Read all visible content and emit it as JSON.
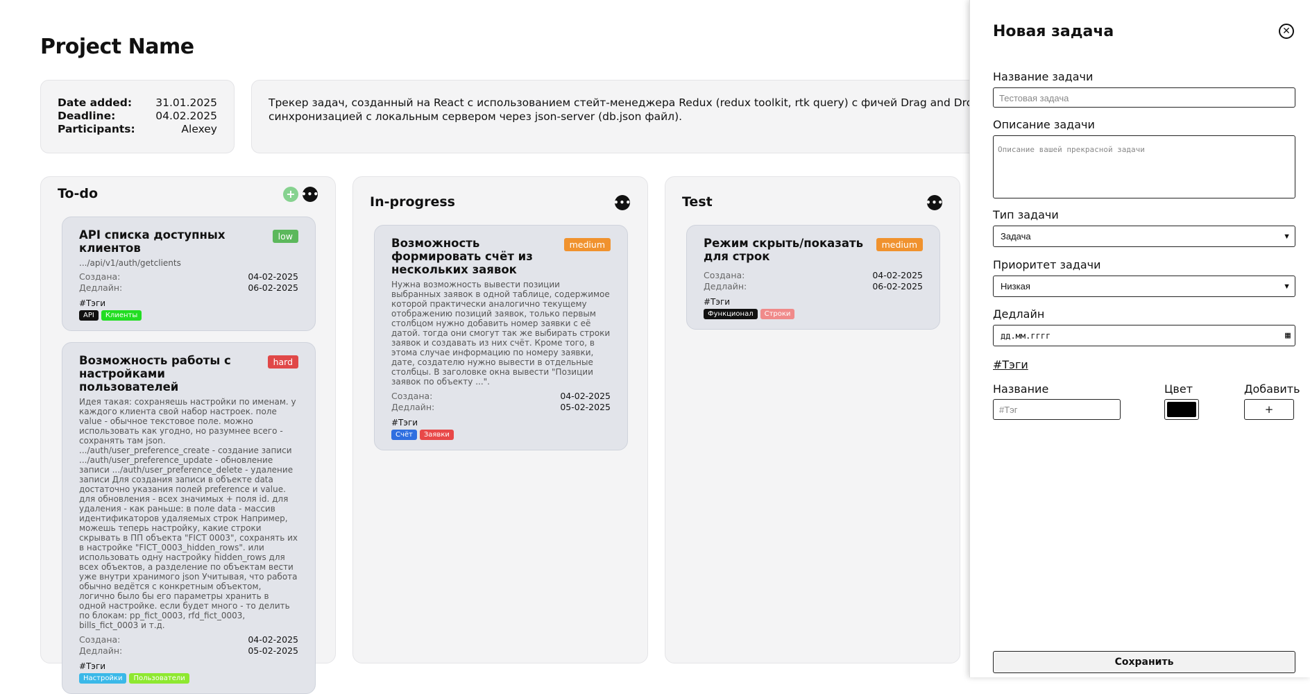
{
  "project": {
    "title": "Project Name",
    "info": {
      "date_added_label": "Date added:",
      "date_added": "31.01.2025",
      "deadline_label": "Deadline:",
      "deadline": "04.02.2025",
      "participants_label": "Participants:",
      "participants": "Alexey"
    },
    "description": "Трекер задач, созданный на React с использованием стейт-менеджера Redux (redux toolkit, rtk query) с фичей Drag and Drop (библиотека react-beautiful-dnd / drag-and-drop) и синхронизацией с локальным сервером через json-server (db.json файл)."
  },
  "columns": [
    {
      "title": "To-do",
      "add_icon": "plus-icon",
      "more_icon": "ellipsis-icon",
      "cards": [
        {
          "title": "API списка доступных клиентов",
          "priority": "low",
          "priority_color": "#5cb85c",
          "description": ".../api/v1/auth/getclients",
          "created_label": "Создана:",
          "created": "04-02-2025",
          "deadline_label": "Дедлайн:",
          "deadline": "06-02-2025",
          "tags_label": "#Тэги",
          "tags": [
            {
              "name": "API",
              "color": "#111111"
            },
            {
              "name": "Клиенты",
              "color": "#22dd22"
            }
          ]
        },
        {
          "title": "Возможность работы с настройками пользователей",
          "priority": "hard",
          "priority_color": "#e04848",
          "description": "Идея такая: сохраняешь настройки по именам. у каждого клиента свой набор настроек. поле value - обычное текстовое поле. можно использовать как угодно, но разумнее всего - сохранять там json. .../auth/user_preference_create - создание записи .../auth/user_preference_update - обновление записи .../auth/user_preference_delete - удаление записи Для создания записи в объекте data достаточно указания полей preference и value. для обновления - всех значимых + поля id. для удаления - как раньше: в поле data - массив идентификаторов удаляемых строк Например, можешь теперь настройку, какие строки скрывать в ПП объекта \"FICT 0003\", сохранять их в настройке \"FICT_0003_hidden_rows\". или использовать одну настройку hidden_rows для всех объектов, а разделение по объектам вести уже внутри хранимого json Учитывая, что работа обычно ведётся с конкретным объектом, логично было бы его параметры хранить в одной настройке. если будет много - то делить по блокам: pp_fict_0003, rfd_fict_0003, bills_fict_0003 и т.д.",
          "created_label": "Создана:",
          "created": "04-02-2025",
          "deadline_label": "Дедлайн:",
          "deadline": "05-02-2025",
          "tags_label": "#Тэги",
          "tags": [
            {
              "name": "Настройки",
              "color": "#3ab8e8"
            },
            {
              "name": "Пользователи",
              "color": "#8ee830"
            }
          ]
        }
      ]
    },
    {
      "title": "In-progress",
      "more_icon": "ellipsis-icon",
      "cards": [
        {
          "title": "Возможность формировать счёт из нескольких заявок",
          "priority": "medium",
          "priority_color": "#f0922e",
          "description": "Нужна возможность вывести позиции выбранных заявок в одной таблице, содержимое которой практически аналогично текущему отображению позиций заявок, только первым столбцом нужно добавить номер заявки с её датой. тогда они смогут так же выбирать строки заявок и создавать из них счёт. Кроме того, в этома случае информацию по номеру заявки, дате, создателю нужно вывести в отдельные столбцы. В заголовке окна вывести \"Позиции заявок по объекту ...\".",
          "created_label": "Создана:",
          "created": "04-02-2025",
          "deadline_label": "Дедлайн:",
          "deadline": "05-02-2025",
          "tags_label": "#Тэги",
          "tags": [
            {
              "name": "Счёт",
              "color": "#2f6fe0"
            },
            {
              "name": "Заявки",
              "color": "#e84848"
            }
          ]
        }
      ]
    },
    {
      "title": "Test",
      "more_icon": "ellipsis-icon",
      "cards": [
        {
          "title": "Режим скрыть/показать для строк",
          "priority": "medium",
          "priority_color": "#f0922e",
          "description": "",
          "created_label": "Создана:",
          "created": "04-02-2025",
          "deadline_label": "Дедлайн:",
          "deadline": "06-02-2025",
          "tags_label": "#Тэги",
          "tags": [
            {
              "name": "Функционал",
              "color": "#111111"
            },
            {
              "name": "Строки",
              "color": "#f08a8a"
            }
          ]
        }
      ]
    }
  ],
  "panel": {
    "title": "Новая задача",
    "close_icon": "close-icon",
    "task_name_label": "Название задачи",
    "task_name_placeholder": "Тестовая задача",
    "task_desc_label": "Описание задачи",
    "task_desc_placeholder": "Описание вашей прекрасной задачи",
    "task_type_label": "Тип задачи",
    "task_type_value": "Задача",
    "priority_label": "Приоритет задачи",
    "priority_value": "Низкая",
    "deadline_label": "Дедлайн",
    "deadline_placeholder": "дд.мм.гггг",
    "tags_link": "#Тэги",
    "tag_name_label": "Название",
    "tag_color_label": "Цвет",
    "tag_add_label": "Добавить",
    "tag_name_placeholder": "#Тэг",
    "tag_color_value": "#000000",
    "tag_add_button": "+",
    "save_button": "Сохранить"
  }
}
